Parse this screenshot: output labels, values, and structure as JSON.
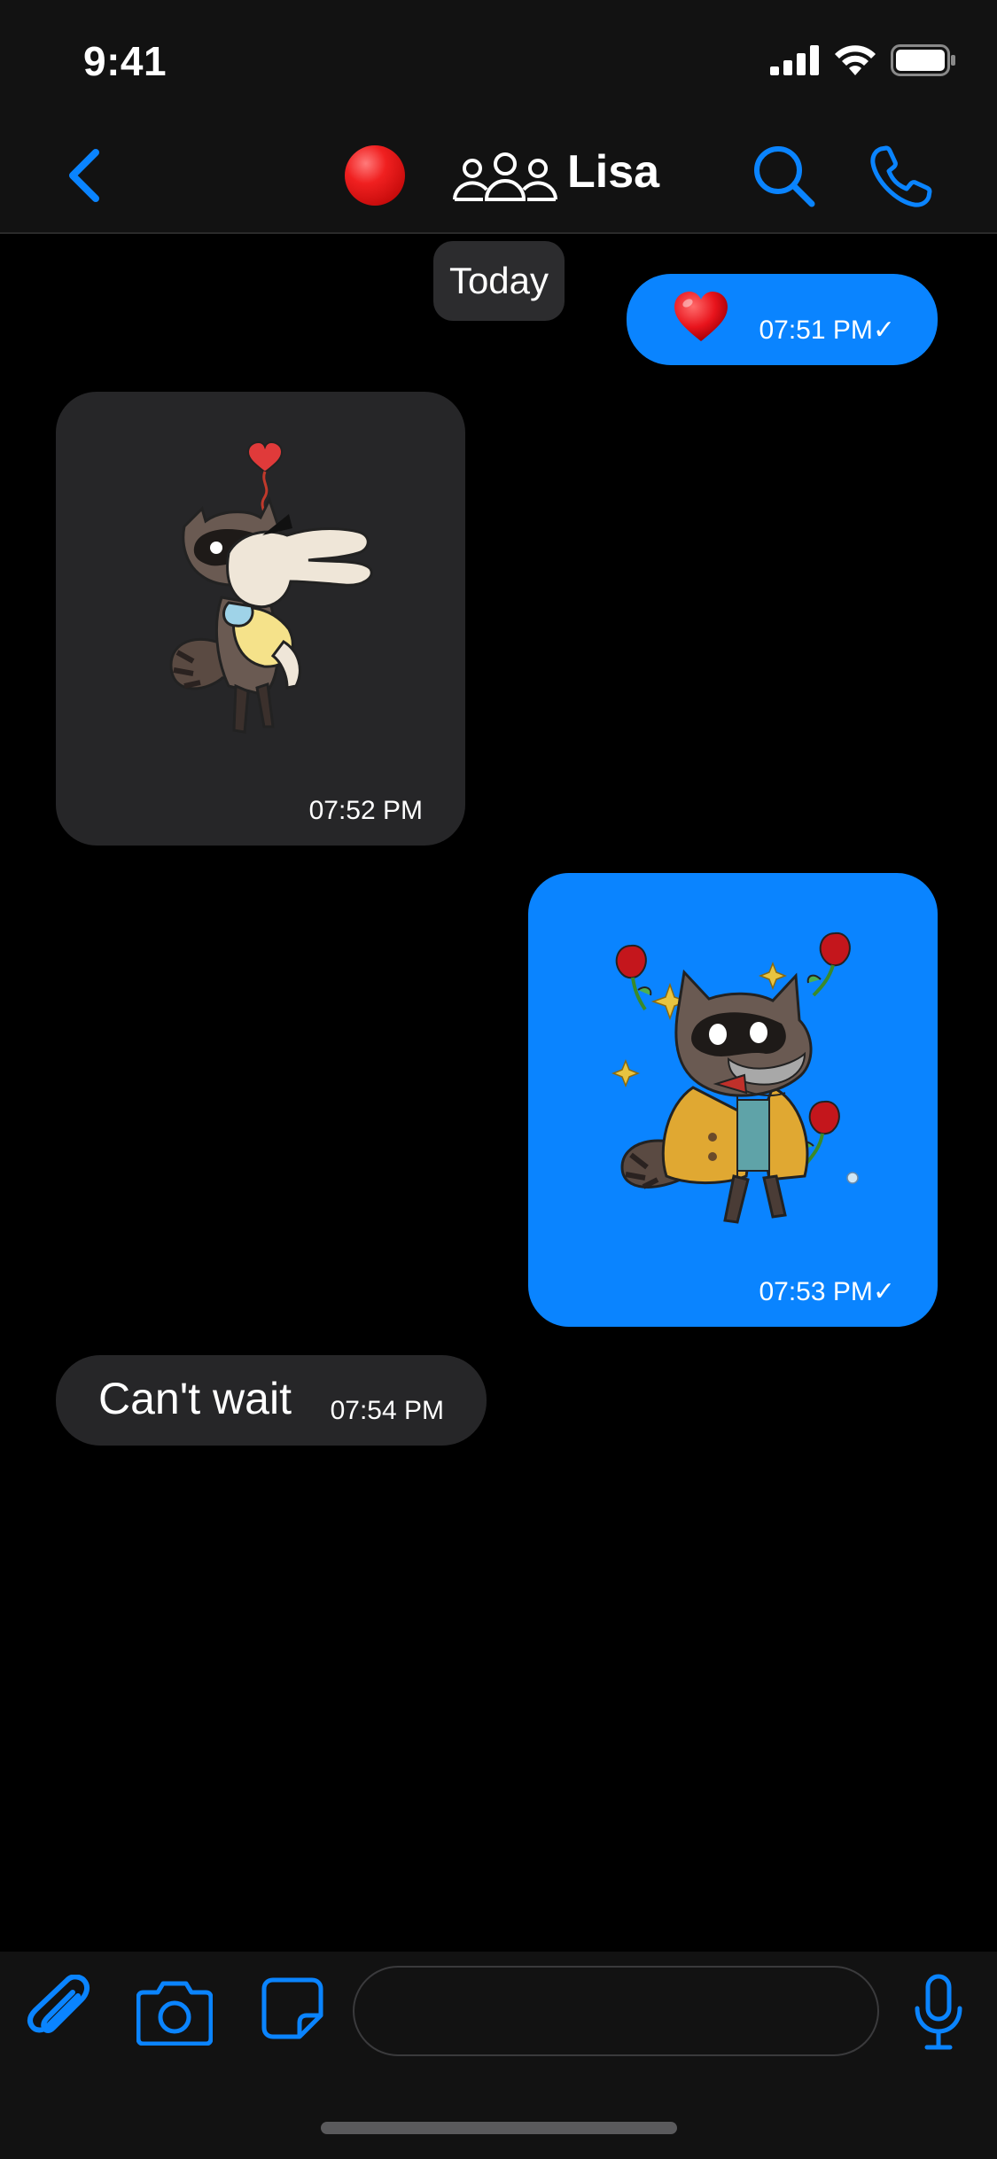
{
  "status_bar": {
    "time": "9:41",
    "icons": [
      "signal-icon",
      "wifi-icon",
      "battery-icon"
    ]
  },
  "header": {
    "back_icon": "chevron-left-icon",
    "status_icon": "red-circle-icon",
    "group_icon": "group-icon",
    "title": "Lisa",
    "search_icon": "search-icon",
    "call_icon": "phone-icon"
  },
  "chat": {
    "date_label": "Today",
    "messages": [
      {
        "direction": "outgoing",
        "type": "emoji",
        "content": "heart-emoji",
        "time": "07:51 PM✓"
      },
      {
        "direction": "incoming",
        "type": "sticker",
        "content": "raccoon-hugging-bunny-sticker",
        "time": "07:52 PM"
      },
      {
        "direction": "outgoing",
        "type": "sticker",
        "content": "raccoon-with-roses-sticker",
        "time": "07:53 PM✓"
      },
      {
        "direction": "incoming",
        "type": "text",
        "content": "Can't wait",
        "time": "07:54 PM"
      }
    ]
  },
  "composer": {
    "attach_icon": "paperclip-icon",
    "camera_icon": "camera-icon",
    "sticker_icon": "sticker-icon",
    "input_value": "",
    "input_placeholder": "",
    "mic_icon": "microphone-icon"
  },
  "colors": {
    "accent": "#0a84ff",
    "incoming_bubble": "#262628",
    "bar_background": "#121212",
    "background": "#000000"
  }
}
